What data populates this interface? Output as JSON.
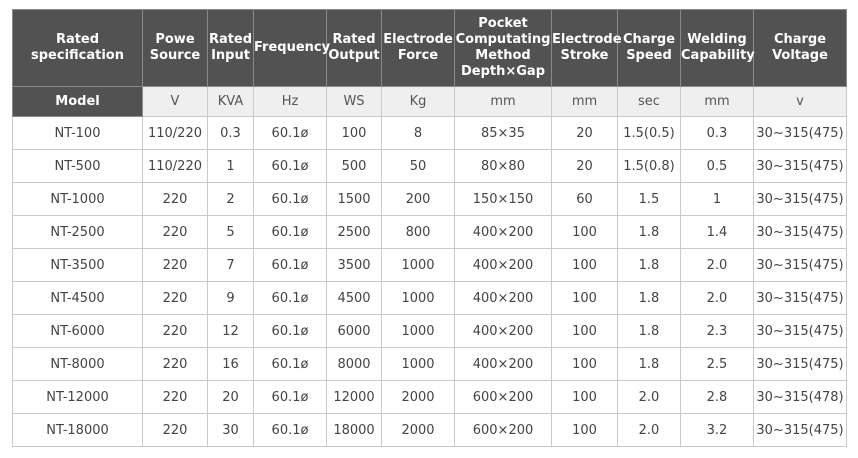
{
  "headers": [
    "Rated specification",
    "Powe\nSource",
    "Rated\nInput",
    "Frequency",
    "Rated\nOutput",
    "Electrode\nForce",
    "Pocket\nComputating\nMethod\nDepth×Gap",
    "Electrode\nStroke",
    "Charge\nSpeed",
    "Welding\nCapability",
    "Charge\nVoltage"
  ],
  "units": [
    "Model",
    "V",
    "KVA",
    "Hz",
    "WS",
    "Kg",
    "mm",
    "mm",
    "sec",
    "mm",
    "v"
  ],
  "rows": [
    [
      "NT-100",
      "110/220",
      "0.3",
      "60.1ø",
      "100",
      "8",
      "85×35",
      "20",
      "1.5(0.5)",
      "0.3",
      "30~315(475)"
    ],
    [
      "NT-500",
      "110/220",
      "1",
      "60.1ø",
      "500",
      "50",
      "80×80",
      "20",
      "1.5(0.8)",
      "0.5",
      "30~315(475)"
    ],
    [
      "NT-1000",
      "220",
      "2",
      "60.1ø",
      "1500",
      "200",
      "150×150",
      "60",
      "1.5",
      "1",
      "30~315(475)"
    ],
    [
      "NT-2500",
      "220",
      "5",
      "60.1ø",
      "2500",
      "800",
      "400×200",
      "100",
      "1.8",
      "1.4",
      "30~315(475)"
    ],
    [
      "NT-3500",
      "220",
      "7",
      "60.1ø",
      "3500",
      "1000",
      "400×200",
      "100",
      "1.8",
      "2.0",
      "30~315(475)"
    ],
    [
      "NT-4500",
      "220",
      "9",
      "60.1ø",
      "4500",
      "1000",
      "400×200",
      "100",
      "1.8",
      "2.0",
      "30~315(475)"
    ],
    [
      "NT-6000",
      "220",
      "12",
      "60.1ø",
      "6000",
      "1000",
      "400×200",
      "100",
      "1.8",
      "2.3",
      "30~315(475)"
    ],
    [
      "NT-8000",
      "220",
      "16",
      "60.1ø",
      "8000",
      "1000",
      "400×200",
      "100",
      "1.8",
      "2.5",
      "30~315(475)"
    ],
    [
      "NT-12000",
      "220",
      "20",
      "60.1ø",
      "12000",
      "2000",
      "600×200",
      "100",
      "2.0",
      "2.8",
      "30~315(478)"
    ],
    [
      "NT-18000",
      "220",
      "30",
      "60.1ø",
      "18000",
      "2000",
      "600×200",
      "100",
      "2.0",
      "3.2",
      "30~315(475)"
    ]
  ]
}
